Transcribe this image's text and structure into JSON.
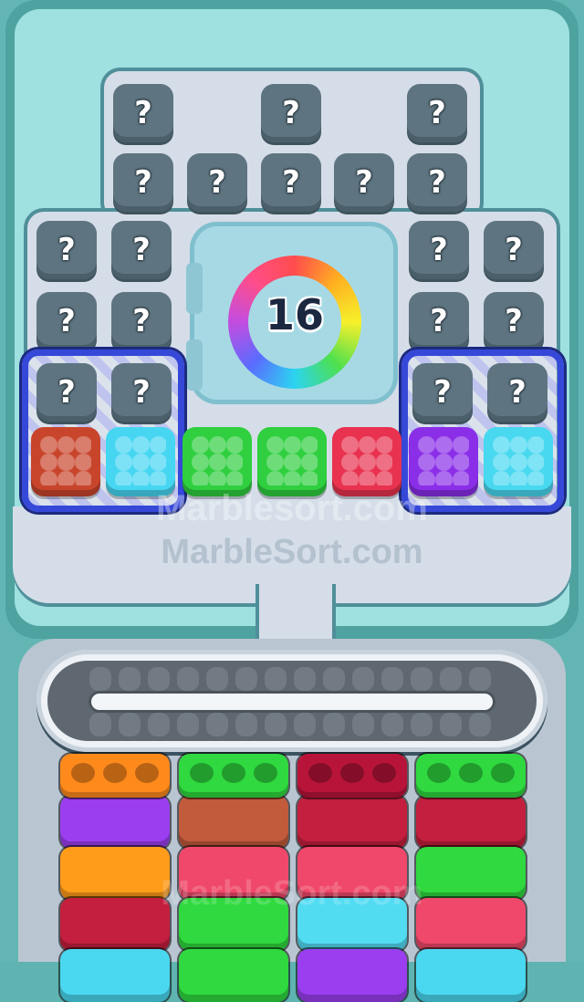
{
  "level_counter": "16",
  "mystery_label": "?",
  "watermarks": [
    "Marblesort.com",
    "MarbleSort.com",
    "MarbleSort.com"
  ],
  "colors": {
    "board_bg": "#9fe0e0",
    "tile": "#5e7581",
    "cage": "#3548d8"
  },
  "crates": [
    {
      "color": "#c8452c",
      "caged": true
    },
    {
      "color": "#46d6f2",
      "caged": true
    },
    {
      "color": "#2fcf3f",
      "caged": false
    },
    {
      "color": "#2fcf3f",
      "caged": false
    },
    {
      "color": "#e8324f",
      "caged": false
    },
    {
      "color": "#8a2ee8",
      "caged": true
    },
    {
      "color": "#48d8f0",
      "caged": true
    }
  ],
  "stacks": [
    {
      "top": "#ff8a1c",
      "blocks": [
        "#9b3ef0",
        "#ff9c1a",
        "#c41f3e",
        "#4ad8f0"
      ]
    },
    {
      "top": "#2fd93f",
      "blocks": [
        "#c25a3c",
        "#f0486a",
        "#2fd93f",
        "#2fd93f"
      ]
    },
    {
      "top": "#b8143a",
      "blocks": [
        "#c41f3e",
        "#f0486a",
        "#52dcf2",
        "#9b3ef0"
      ]
    },
    {
      "top": "#2fd93f",
      "blocks": [
        "#c41f3e",
        "#2fd93f",
        "#f0486a",
        "#4ad8f0"
      ]
    }
  ]
}
